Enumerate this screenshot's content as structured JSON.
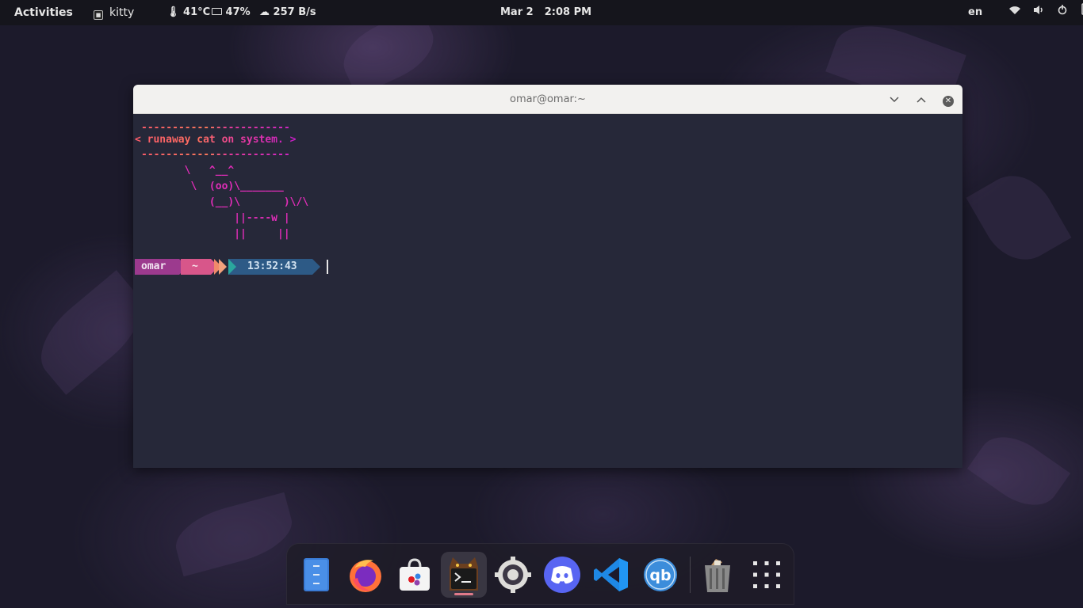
{
  "topbar": {
    "activities": "Activities",
    "app_name": "kitty",
    "temperature": "41°C",
    "battery": "47%",
    "net_speed": "257 B/s",
    "date": "Mar 2",
    "time": "2:08 PM",
    "language": "en"
  },
  "window": {
    "title": "omar@omar:~"
  },
  "terminal": {
    "cow_top": "------------------------",
    "cow_message": "< runaway cat on system. >",
    "cow_bottom": "------------------------",
    "cat_line1": "        \\   ^__^",
    "cat_line2": "         \\  (oo)\\_______",
    "cat_line3": "            (__)\\       )\\/\\",
    "cat_line4": "                ||----w |",
    "cat_line5": "                ||     ||",
    "prompt_user": "omar",
    "prompt_dir": "~",
    "prompt_time": "13:52:43"
  },
  "dock": {
    "items": [
      "files",
      "firefox",
      "software-store",
      "kitty",
      "settings",
      "discord",
      "vscode",
      "qbittorrent",
      "trash",
      "show-applications"
    ]
  },
  "colors": {
    "terminal_bg": "#262839",
    "cat_pink": "#e02db8",
    "prompt_user_bg": "#9c3a8e",
    "prompt_dir_bg": "#d8568a",
    "prompt_time_bg": "#2d5a86"
  }
}
